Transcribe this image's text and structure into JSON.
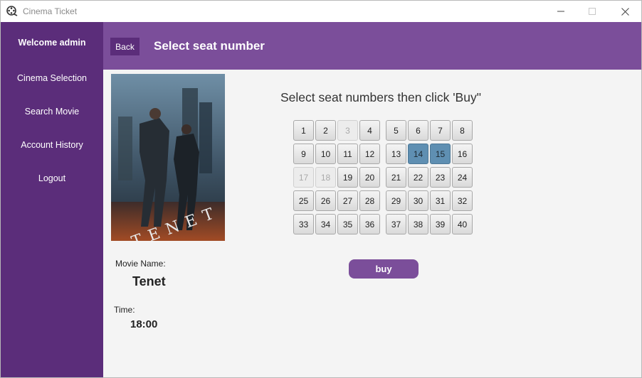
{
  "window": {
    "title": "Cinema Ticket"
  },
  "sidebar": {
    "welcome": "Welcome admin",
    "items": [
      {
        "label": "Cinema Selection"
      },
      {
        "label": "Search Movie"
      },
      {
        "label": "Account History"
      },
      {
        "label": "Logout"
      }
    ]
  },
  "header": {
    "back_label": "Back",
    "title": "Select seat number"
  },
  "main": {
    "instruction": "Select seat numbers then click 'Buy\"",
    "movie_name_label": "Movie Name:",
    "movie_name": "Tenet",
    "time_label": "Time:",
    "time": "18:00",
    "buy_label": "buy",
    "poster_title": "TENET"
  },
  "seats": {
    "numbers": [
      "1",
      "2",
      "3",
      "4",
      "5",
      "6",
      "7",
      "8",
      "9",
      "10",
      "11",
      "12",
      "13",
      "14",
      "15",
      "16",
      "17",
      "18",
      "19",
      "20",
      "21",
      "22",
      "23",
      "24",
      "25",
      "26",
      "27",
      "28",
      "29",
      "30",
      "31",
      "32",
      "33",
      "34",
      "35",
      "36",
      "37",
      "38",
      "39",
      "40"
    ],
    "disabled": [
      "3",
      "17",
      "18"
    ],
    "selected": [
      "14",
      "15"
    ]
  },
  "colors": {
    "sidebar": "#5b2d7a",
    "header": "#7b4e9a",
    "selected_seat": "#5f8fb2",
    "buy_button": "#7b4e9a"
  }
}
